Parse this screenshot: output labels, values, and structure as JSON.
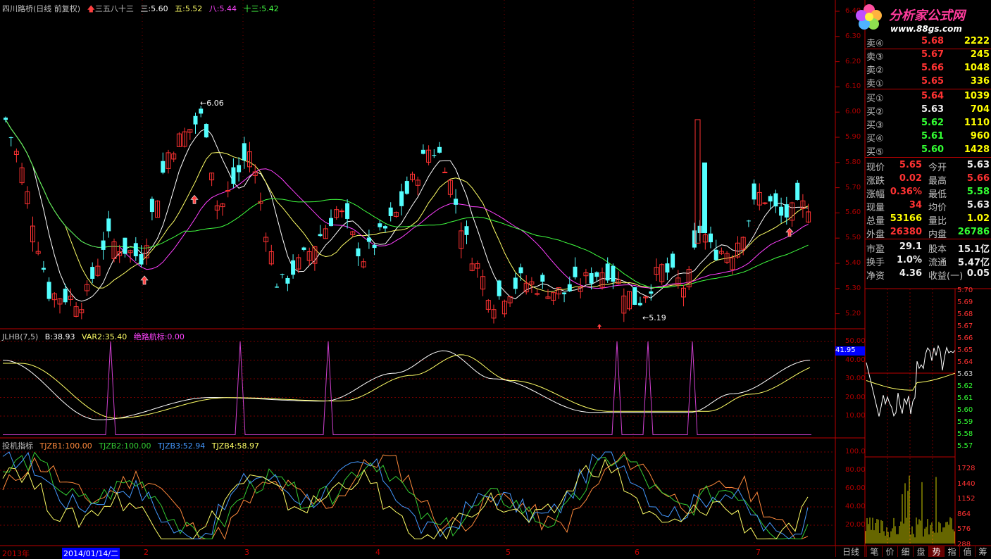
{
  "header": {
    "title": "四川路桥(日线 前复权)",
    "indicator_name": "三五八十三",
    "ma3": "三:5.60",
    "ma5": "五:5.52",
    "ma8": "八:5.44",
    "ma13": "十三:5.42"
  },
  "main_chart": {
    "high_label": "6.06",
    "low_label": "5.19",
    "y_ticks": [
      "6.40",
      "6.30",
      "6.20",
      "6.10",
      "6.00",
      "5.90",
      "5.80",
      "5.70",
      "5.60",
      "5.50",
      "5.40",
      "5.30",
      "5.20"
    ]
  },
  "indicator1": {
    "name": "JLHB(7,5)",
    "b": "B:38.93",
    "var2": "VAR2:35.40",
    "jueLu": "绝路航标:0.00",
    "y_ticks": [
      "50.00",
      "40.00",
      "30.00",
      "20.00",
      "10.00"
    ],
    "current_badge": "41.95"
  },
  "indicator2": {
    "name": "投机指标",
    "tjzb1": "TJZB1:100.00",
    "tjzb2": "TJZB2:100.00",
    "tjzb3": "TJZB3:52.94",
    "tjzb4": "TJZB4:58.97",
    "y_ticks": [
      "100.0",
      "80.00",
      "60.00",
      "40.00",
      "20.00"
    ]
  },
  "dates": {
    "start": "2013年",
    "cursor": "2014/01/14/二",
    "months": [
      "2",
      "3",
      "4",
      "5",
      "6",
      "7"
    ]
  },
  "logo": {
    "text": "分析家公式网",
    "url": "www.88gs.com"
  },
  "quote": {
    "sell": [
      {
        "label": "卖④",
        "price": "5.68",
        "vol": "2222"
      },
      {
        "label": "卖③",
        "price": "5.67",
        "vol": "245"
      },
      {
        "label": "卖②",
        "price": "5.66",
        "vol": "1048"
      },
      {
        "label": "卖①",
        "price": "5.65",
        "vol": "336"
      }
    ],
    "buy": [
      {
        "label": "买①",
        "price": "5.64",
        "vol": "1039"
      },
      {
        "label": "买②",
        "price": "5.63",
        "vol": "704"
      },
      {
        "label": "买③",
        "price": "5.62",
        "vol": "1110"
      },
      {
        "label": "买④",
        "price": "5.61",
        "vol": "960"
      },
      {
        "label": "买⑤",
        "price": "5.60",
        "vol": "1428"
      }
    ],
    "stats": [
      {
        "l1": "现价",
        "v1": "5.65",
        "l2": "今开",
        "v2": "5.63"
      },
      {
        "l1": "涨跌",
        "v1": "0.02",
        "l2": "最高",
        "v2": "5.66"
      },
      {
        "l1": "涨幅",
        "v1": "0.36%",
        "l2": "最低",
        "v2": "5.58"
      },
      {
        "l1": "现量",
        "v1": "34",
        "l2": "均价",
        "v2": "5.63"
      },
      {
        "l1": "总量",
        "v1": "53166",
        "l2": "量比",
        "v2": "1.02"
      },
      {
        "l1": "外盘",
        "v1": "26380",
        "l2": "内盘",
        "v2": "26786"
      }
    ],
    "fund": [
      {
        "l1": "市盈",
        "v1": "29.1",
        "l2": "股本",
        "v2": "15.1亿"
      },
      {
        "l1": "换手",
        "v1": "1.0%",
        "l2": "流通",
        "v2": "5.47亿"
      },
      {
        "l1": "净资",
        "v1": "4.36",
        "l2": "收益(一)",
        "v2": "0.05"
      }
    ]
  },
  "mini_chart": {
    "price_ticks": [
      "5.70",
      "5.69",
      "5.68",
      "5.67",
      "5.66",
      "5.65",
      "5.64",
      "5.63",
      "5.62",
      "5.61",
      "5.60",
      "5.59",
      "5.58",
      "5.57"
    ],
    "vol_ticks": [
      "1728",
      "1440",
      "1152",
      "864",
      "576",
      "288"
    ]
  },
  "tabs": {
    "period": "日线",
    "items": [
      "笔",
      "价",
      "细",
      "盘",
      "势",
      "指",
      "值",
      "筹"
    ],
    "active": "势"
  },
  "colors": {
    "up": "#ff3232",
    "down": "#54ffff",
    "ma3": "#ffffff",
    "ma5": "#ffff66",
    "ma8": "#ff40ff",
    "ma13": "#40ff40"
  }
}
